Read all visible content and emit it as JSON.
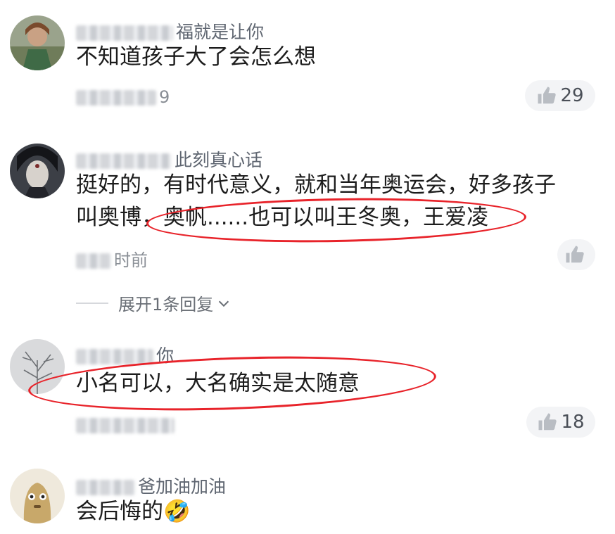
{
  "comments": [
    {
      "username_visible": "福就是让你",
      "text": "不知道孩子大了会怎么想",
      "meta_visible": "9",
      "likes": "29"
    },
    {
      "username_visible": "此刻真心话",
      "text_line1": "挺好的，有时代意义，就和当年奥运会，好多孩子",
      "text_line2": "叫奥博，奥帆......也可以叫王冬奥，王爱凌",
      "meta_visible": "时前",
      "likes": "",
      "expand_label": "展开1条回复"
    },
    {
      "username_visible": "你",
      "text": "小名可以，大名确实是太随意",
      "meta_visible": "",
      "likes": "18"
    },
    {
      "username_visible": "爸加油加油",
      "text": "会后悔的",
      "emoji": "🤣"
    }
  ],
  "icons": {
    "like": "thumbs-up-icon",
    "expand": "chevron-down-icon"
  },
  "colors": {
    "annotation_oval": "#e8232a",
    "like_pill_bg": "#f3f4f6"
  }
}
